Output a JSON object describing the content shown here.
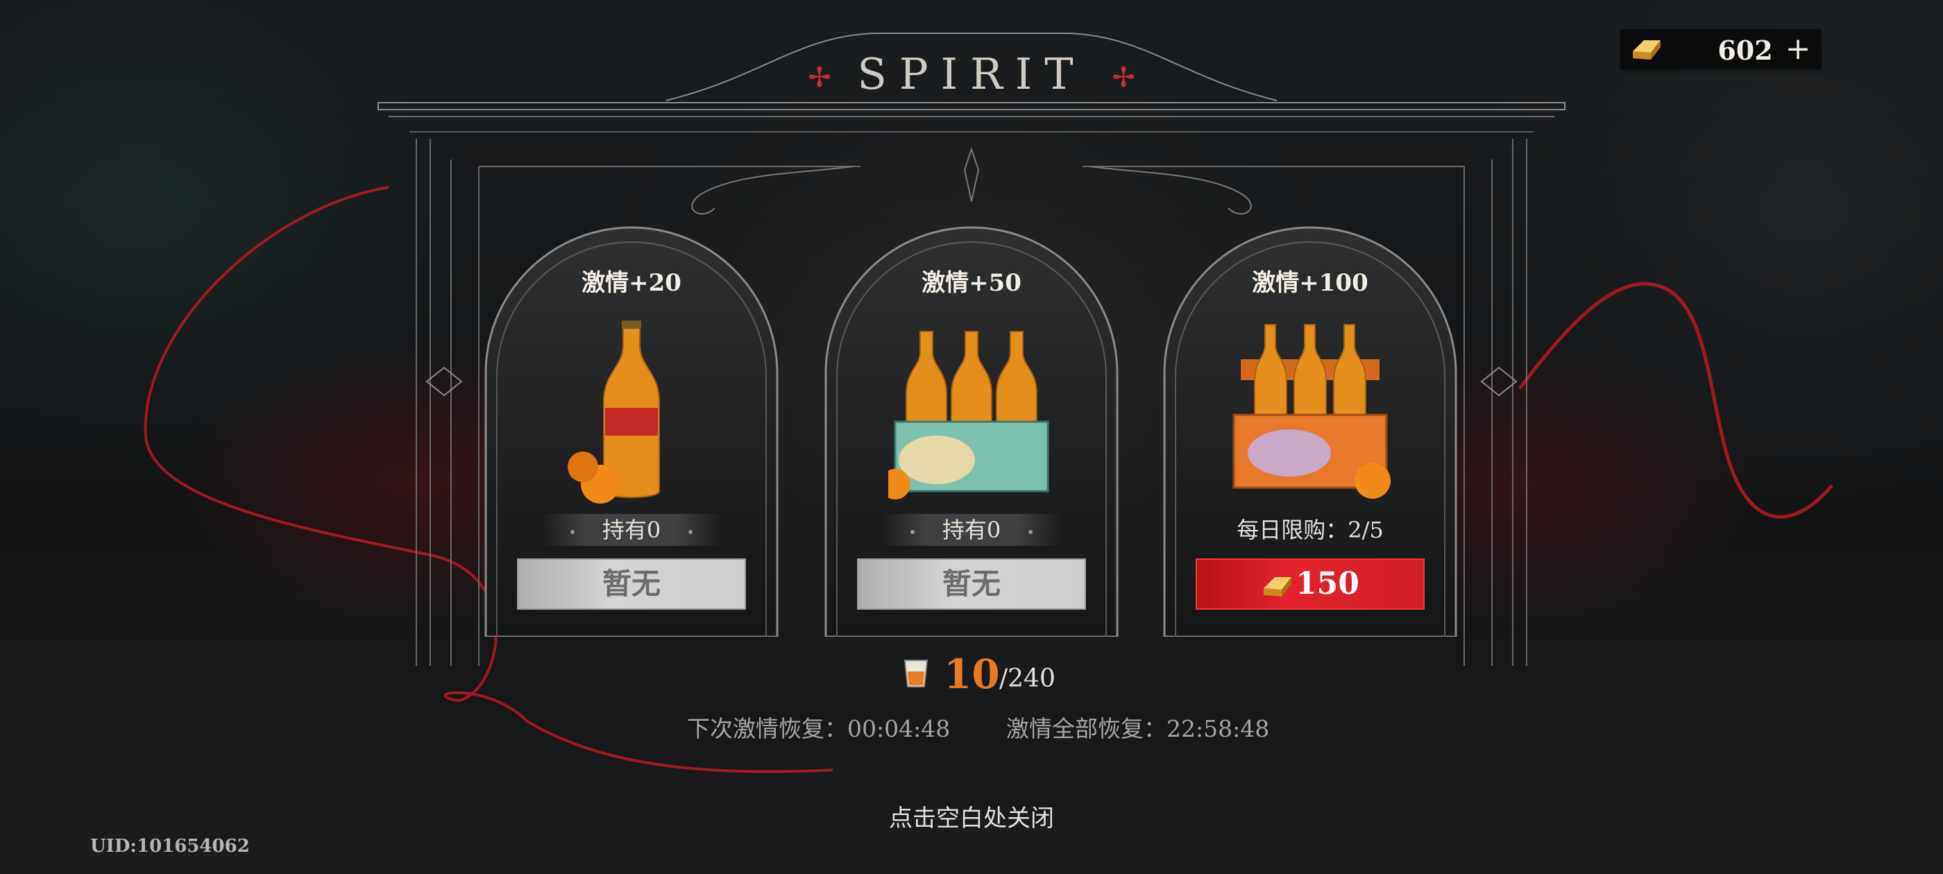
{
  "header": {
    "title": "SPIRIT",
    "title_ornament": "✢"
  },
  "currency": {
    "value": "602",
    "add_label": "+"
  },
  "cards": [
    {
      "label": "激情+20",
      "holding": "持有0",
      "button": "暂无"
    },
    {
      "label": "激情+50",
      "holding": "持有0",
      "button": "暂无"
    },
    {
      "label": "激情+100",
      "limit": "每日限购：2/5",
      "price": "150"
    }
  ],
  "stamina": {
    "current": "10",
    "max": "/240"
  },
  "recovery": {
    "next": "下次激情恢复：00:04:48",
    "full": "激情全部恢复：22:58:48"
  },
  "close_hint": "点击空白处关闭",
  "uid": "UID:101654062",
  "colors": {
    "accent_red": "#e2232b",
    "stamina_orange": "#e87a24",
    "gold": "#e9b440"
  }
}
